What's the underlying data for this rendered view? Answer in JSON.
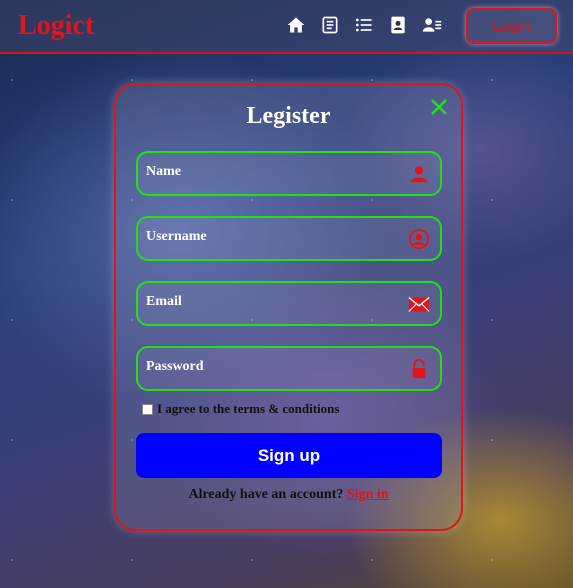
{
  "header": {
    "logo": "Logict",
    "login_label": "Login",
    "nav_icons": [
      "home-icon",
      "notes-icon",
      "list-icon",
      "contact-card-icon",
      "user-details-icon"
    ]
  },
  "form": {
    "title": "Legister",
    "fields": [
      {
        "label": "Name",
        "icon": "user-icon"
      },
      {
        "label": "Username",
        "icon": "user-circle-icon"
      },
      {
        "label": "Email",
        "icon": "envelope-icon"
      },
      {
        "label": "Password",
        "icon": "lock-icon"
      }
    ],
    "terms_label": "I agree to the terms & conditions",
    "signup_label": "Sign up",
    "footer_text": "Already have an account?",
    "signin_label": "Sign in"
  },
  "colors": {
    "accent_red": "#e0141a",
    "field_border": "#1fe01a",
    "primary_button": "#0000ff"
  }
}
